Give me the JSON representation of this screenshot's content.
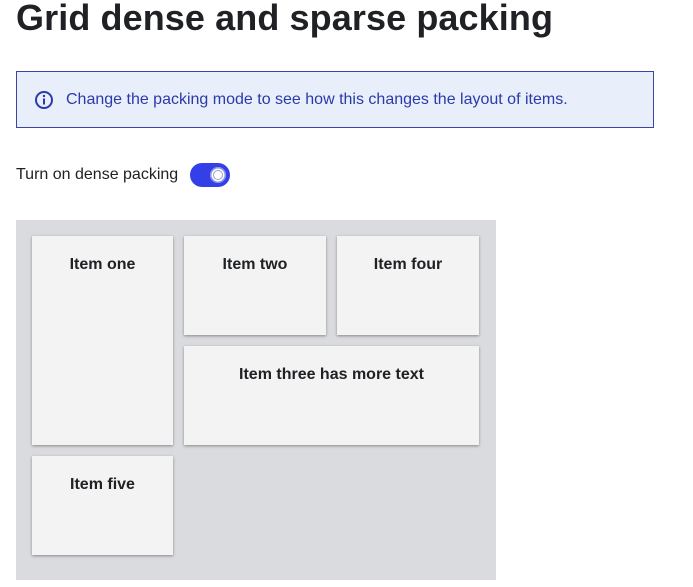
{
  "page": {
    "title": "Grid dense and sparse packing"
  },
  "info": {
    "icon": "info-icon",
    "text": "Change the packing mode to see how this changes the layout of items."
  },
  "toggle": {
    "label": "Turn on dense packing",
    "checked": true,
    "color": "#3340e8"
  },
  "grid": {
    "items": [
      {
        "label": "Item one"
      },
      {
        "label": "Item two"
      },
      {
        "label": "Item four"
      },
      {
        "label": "Item three has more text"
      },
      {
        "label": "Item five"
      }
    ]
  },
  "colors": {
    "info_border": "#3c44a8",
    "info_background": "#e8effb",
    "grid_background": "#dadbde",
    "item_background": "#f2f3f2"
  }
}
